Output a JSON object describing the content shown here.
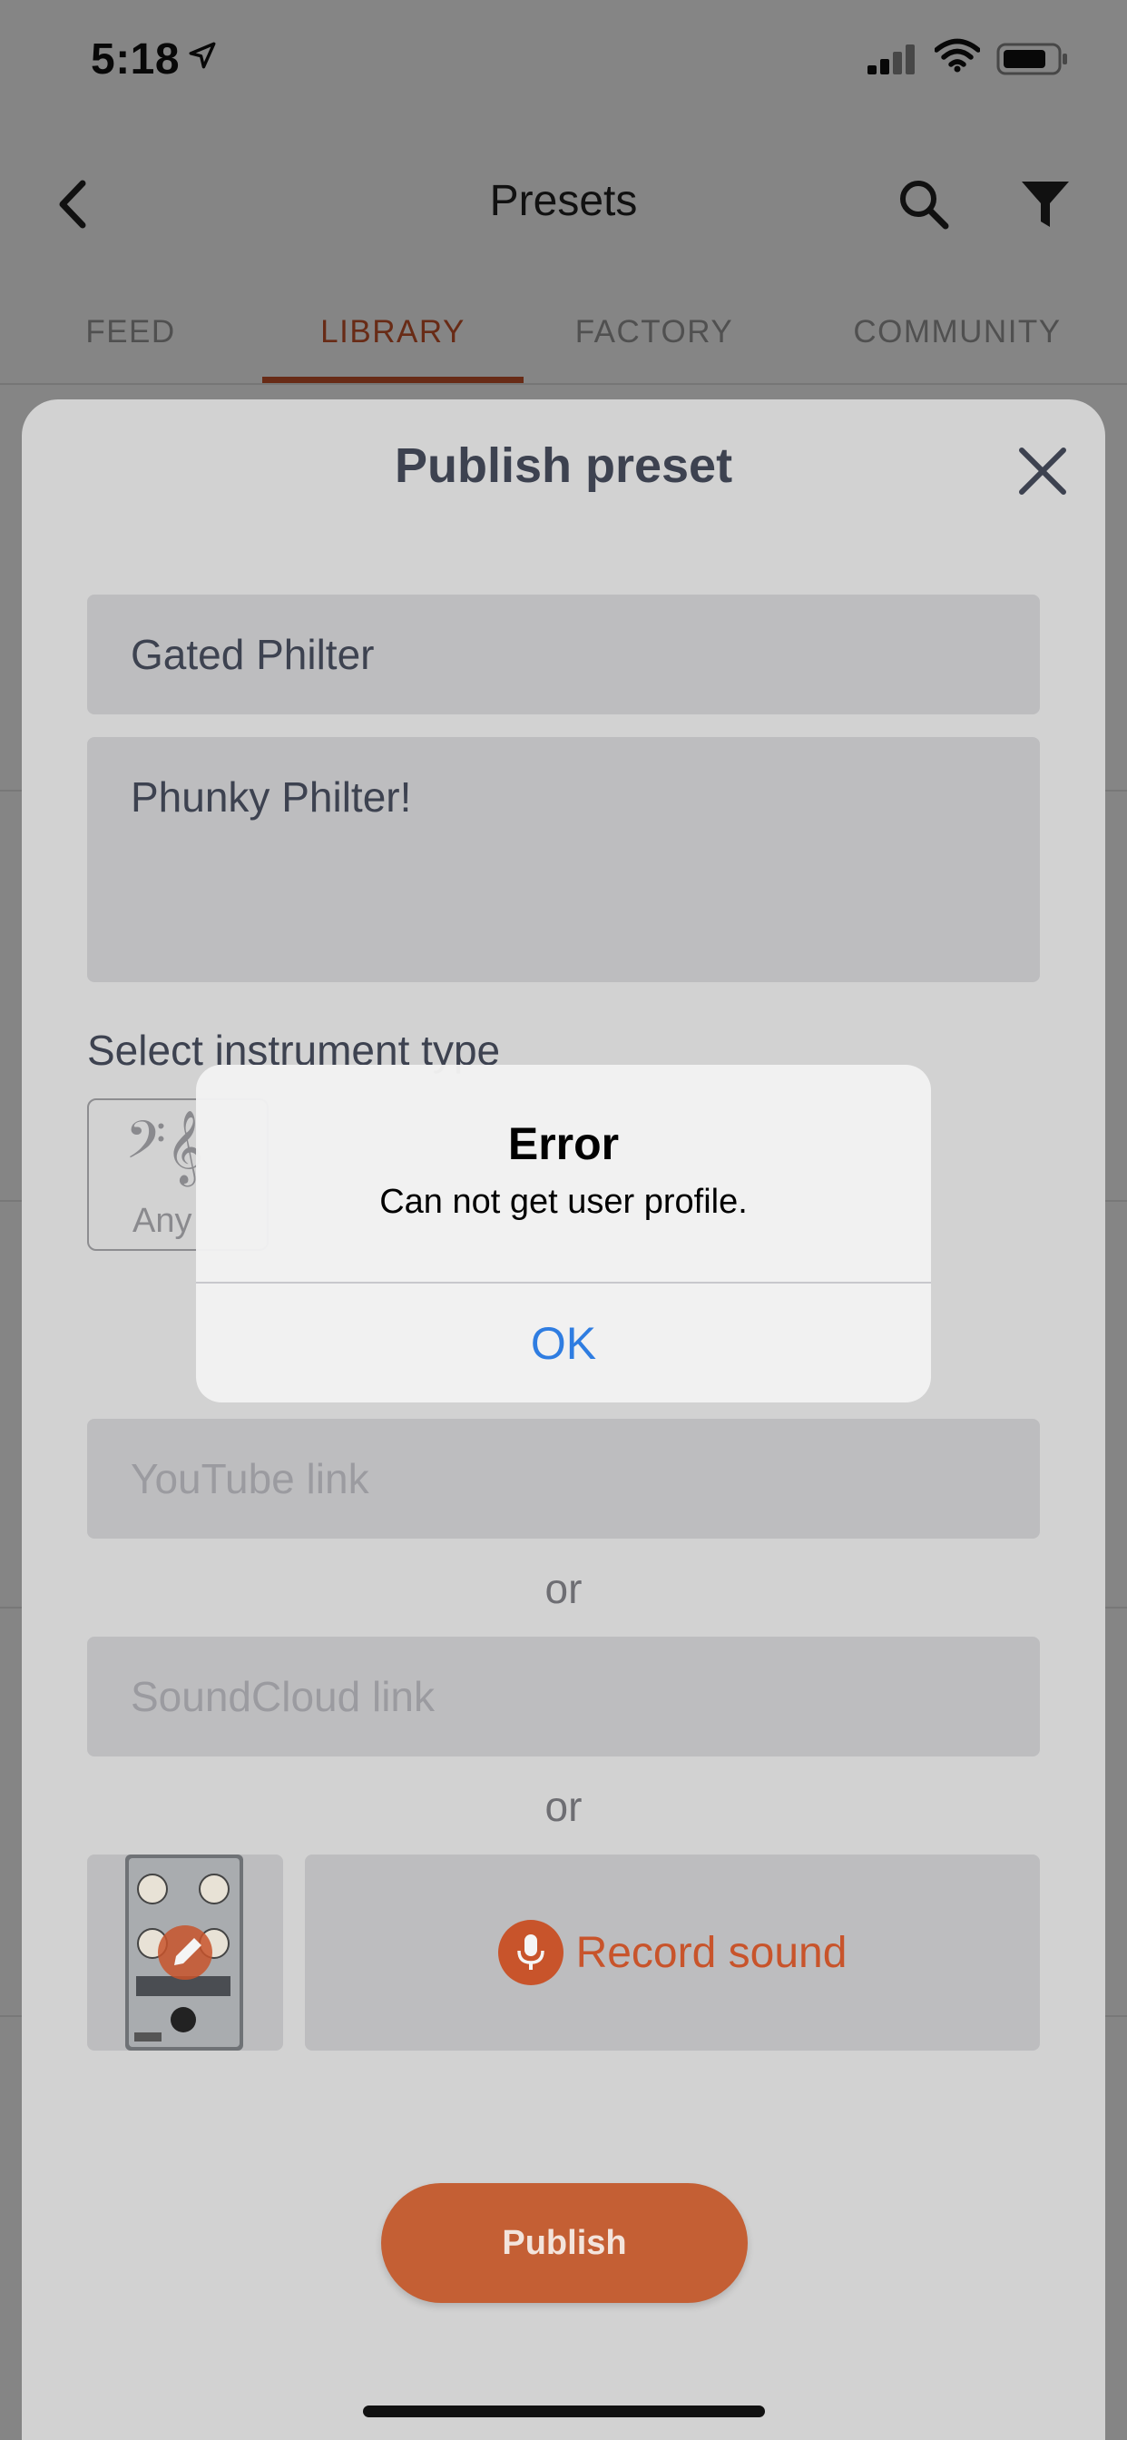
{
  "status_bar": {
    "time": "5:18",
    "icons": [
      "location-arrow-icon",
      "cellular-signal-icon",
      "wifi-icon",
      "battery-icon"
    ]
  },
  "header": {
    "title": "Presets",
    "icons": [
      "chevron-left-icon",
      "search-icon",
      "filter-icon"
    ]
  },
  "tabs": [
    {
      "label": "FEED",
      "active": false
    },
    {
      "label": "LIBRARY",
      "active": true
    },
    {
      "label": "FACTORY",
      "active": false
    },
    {
      "label": "COMMUNITY",
      "active": false
    }
  ],
  "sheet": {
    "title": "Publish preset",
    "name_value": "Gated Philter",
    "description_value": "Phunky Philter!",
    "instrument_section_label": "Select instrument type",
    "instrument_option_label": "Any",
    "youtube_placeholder": "YouTube link",
    "or_label": "or",
    "soundcloud_placeholder": "SoundCloud link",
    "record_label": "Record sound",
    "publish_label": "Publish"
  },
  "alert": {
    "title": "Error",
    "message": "Can not get user profile.",
    "ok_label": "OK"
  },
  "colors": {
    "accent": "#c8542b",
    "alert_button": "#2f7de1",
    "field_background": "#bdbdbf",
    "sheet_background": "#d2d2d2"
  }
}
